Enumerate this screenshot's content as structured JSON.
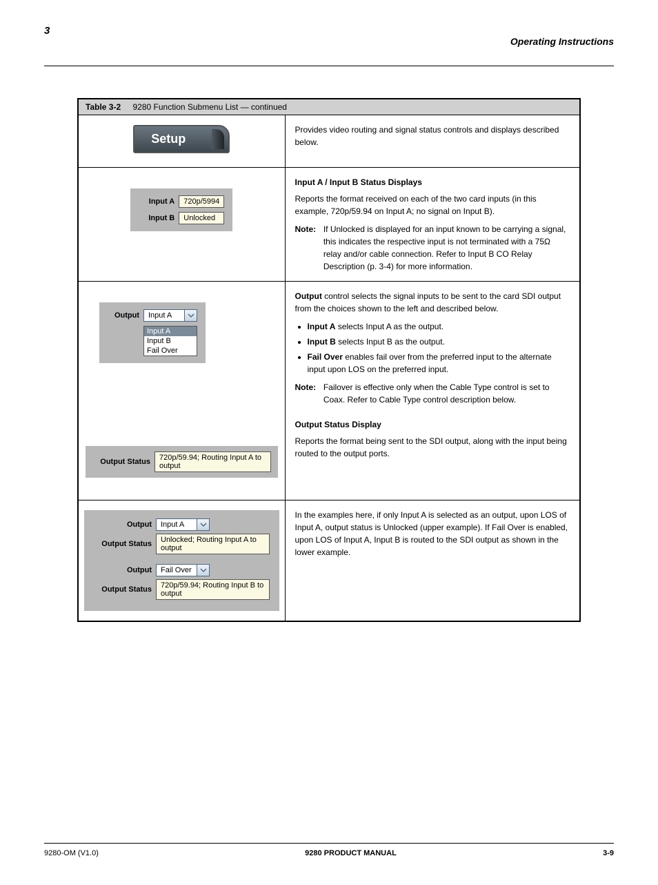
{
  "header": {
    "left": "3",
    "right": "Operating Instructions"
  },
  "table_heading": {
    "left_title": "Table 3-2",
    "left_sub": "9280 Function Submenu List — continued"
  },
  "row1": {
    "button_text": "Setup",
    "right": "Provides video routing and signal status controls and displays described below."
  },
  "row2": {
    "input_a_label": "Input A",
    "input_a_value": "720p/5994",
    "input_b_label": "Input B",
    "input_b_value": "Unlocked",
    "right_title": "Input A / Input B Status Displays",
    "right_body": "Reports the format received on each of the two card inputs (in this example, 720p/59.94 on Input A; no signal on Input B).",
    "note_label": "Note:",
    "note_body": "If Unlocked is displayed for an input known to be carrying a signal, this indicates the respective input is not terminated with a 75Ω relay and/or cable connection. Refer to Input B CO Relay Description (p. 3-4) for more information."
  },
  "row3a": {
    "output_label": "Output",
    "output_value": "Input A",
    "dd_options": [
      "Input A",
      "Input B",
      "Fail Over"
    ],
    "right_title_prefix": "Output ",
    "right_title_rest": "control selects the signal inputs to be sent to the card SDI output from the choices shown to the left and described below.",
    "bullets": [
      {
        "bold": "Input A",
        "rest": " selects Input A as the output."
      },
      {
        "bold": "Input B",
        "rest": " selects Input B as the output."
      },
      {
        "bold": "Fail Over",
        "rest": " enables fail over from the preferred input to the alternate input upon LOS on the preferred input."
      }
    ],
    "note_label": "Note:",
    "note_body": "Failover is effective only when the Cable Type control is set to Coax. Refer to Cable Type control description below."
  },
  "row3b": {
    "os_label": "Output Status",
    "os_value": "720p/59.94; Routing Input A to output",
    "right_title": "Output Status Display",
    "right_body": "Reports the format being sent to the SDI output, along with the input being routed to the output ports."
  },
  "row4": {
    "ex1": {
      "output_label": "Output",
      "output_value": "Input A",
      "status_label": "Output Status",
      "status_value": "Unlocked; Routing Input A to output"
    },
    "ex2": {
      "output_label": "Output",
      "output_value": "Fail Over",
      "status_label": "Output Status",
      "status_value": "720p/59.94; Routing Input B to output"
    },
    "right_body": "In the examples here, if only Input A is selected as an output, upon LOS of Input A, output status is Unlocked (upper example). If Fail Over is enabled, upon LOS of Input A, Input B is routed to the SDI output as shown in the lower example."
  },
  "footer": {
    "left": "9280-OM (V1.0)",
    "center": "9280 PRODUCT MANUAL",
    "right": "3-9"
  }
}
